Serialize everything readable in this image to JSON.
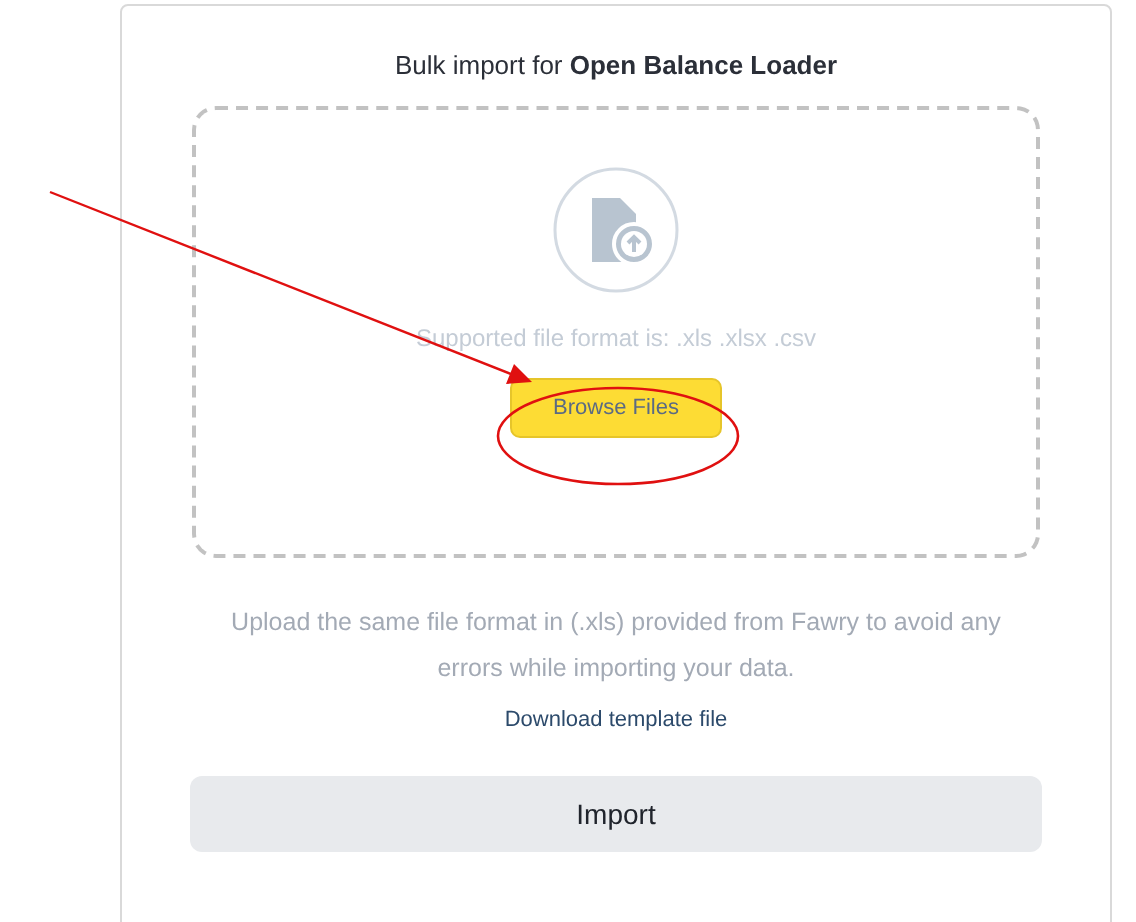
{
  "title": "Bulk import for **Open Balance Loader**",
  "dropzone": {
    "supported_formats": "Supported file format is: .xls .xlsx .csv",
    "browse_button": "Browse Files"
  },
  "hint": "Upload the same file format in (.xls) provided from Fawry to avoid any errors while importing your data.",
  "template_link": "Download template file",
  "import_button": "Import"
}
